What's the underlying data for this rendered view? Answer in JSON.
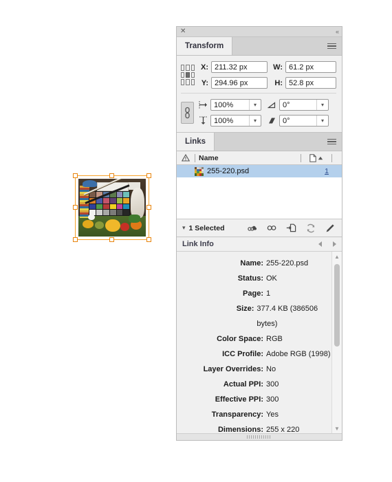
{
  "window": {
    "close_label": "✕",
    "collapse_label": "«"
  },
  "transform": {
    "tab_label": "Transform",
    "menu_icon": "hamburger-menu-icon",
    "proxy_icon": "reference-point-proxy",
    "fields": {
      "x_label": "X:",
      "x_value": "211.32 px",
      "y_label": "Y:",
      "y_value": "294.96 px",
      "w_label": "W:",
      "w_value": "61.2 px",
      "h_label": "H:",
      "h_value": "52.8 px"
    },
    "constrain_icon": "chain-link-constrain-icon",
    "scale_x_icon": "scale-horizontal-icon",
    "scale_y_icon": "scale-vertical-icon",
    "scale_x_value": "100%",
    "scale_y_value": "100%",
    "rotate_icon": "rotation-angle-icon",
    "shear_icon": "shear-angle-icon",
    "rotate_value": "0°",
    "shear_value": "0°"
  },
  "links": {
    "tab_label": "Links",
    "menu_icon": "hamburger-menu-icon",
    "columns": {
      "warning_icon": "warning-triangle-icon",
      "name": "Name",
      "page_icon": "page-column-icon",
      "sort_icon": "sort-ascending-icon"
    },
    "rows": [
      {
        "name": "255-220.psd",
        "page": "1",
        "thumbnail": "image-thumbnail"
      }
    ],
    "toolbar": {
      "caret_icon": "chevron-down-icon",
      "selection_label": "1 Selected",
      "icons": [
        "relink-from-cloud-icon",
        "relink-icon",
        "go-to-link-icon",
        "update-link-icon",
        "edit-original-icon"
      ]
    }
  },
  "link_info": {
    "title": "Link Info",
    "prev_icon": "previous-link-icon",
    "next_icon": "next-link-icon",
    "rows": [
      {
        "key": "Name:",
        "value": "255-220.psd"
      },
      {
        "key": "Status:",
        "value": "OK"
      },
      {
        "key": "Page:",
        "value": "1"
      },
      {
        "key": "Size:",
        "value": "377.4 KB (386506 bytes)"
      },
      {
        "key": "Color Space:",
        "value": "RGB"
      },
      {
        "key": "ICC Profile:",
        "value": "Adobe RGB (1998)"
      },
      {
        "key": "Layer Overrides:",
        "value": "No"
      },
      {
        "key": "Actual PPI:",
        "value": "300"
      },
      {
        "key": "Effective PPI:",
        "value": "300"
      },
      {
        "key": "Transparency:",
        "value": "Yes"
      },
      {
        "key": "Dimensions:",
        "value": "255 x 220"
      }
    ],
    "scroll_up_icon": "scroll-up-arrow-icon",
    "scroll_down_icon": "scroll-down-arrow-icon"
  },
  "canvas": {
    "placed_image_name": "255-220.psd",
    "selection_handles": 8
  },
  "colors": {
    "selection_blue": "#b4d0ec",
    "handle_orange": "#e8840c",
    "panel_bg": "#f0f0f0",
    "tab_inactive": "#d2d2d2",
    "link_text": "#2a4b8d"
  }
}
